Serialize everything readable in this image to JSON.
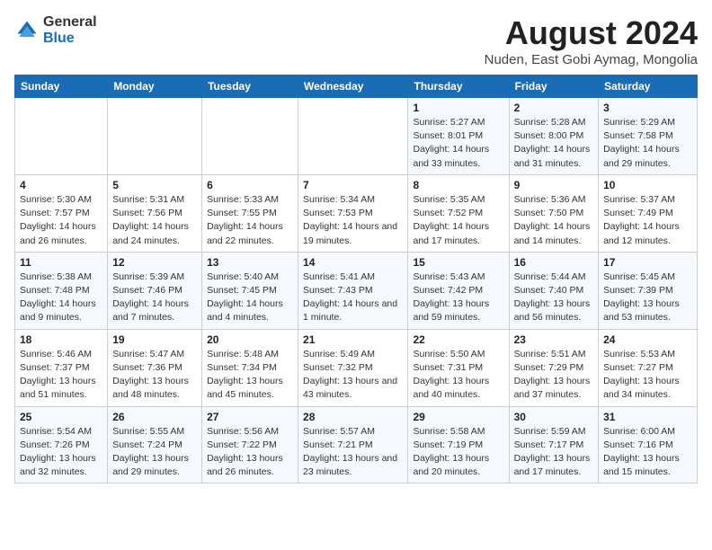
{
  "header": {
    "logo_general": "General",
    "logo_blue": "Blue",
    "title": "August 2024",
    "subtitle": "Nuden, East Gobi Aymag, Mongolia"
  },
  "calendar": {
    "days_of_week": [
      "Sunday",
      "Monday",
      "Tuesday",
      "Wednesday",
      "Thursday",
      "Friday",
      "Saturday"
    ],
    "weeks": [
      [
        {
          "day": "",
          "detail": ""
        },
        {
          "day": "",
          "detail": ""
        },
        {
          "day": "",
          "detail": ""
        },
        {
          "day": "",
          "detail": ""
        },
        {
          "day": "1",
          "detail": "Sunrise: 5:27 AM\nSunset: 8:01 PM\nDaylight: 14 hours\nand 33 minutes."
        },
        {
          "day": "2",
          "detail": "Sunrise: 5:28 AM\nSunset: 8:00 PM\nDaylight: 14 hours\nand 31 minutes."
        },
        {
          "day": "3",
          "detail": "Sunrise: 5:29 AM\nSunset: 7:58 PM\nDaylight: 14 hours\nand 29 minutes."
        }
      ],
      [
        {
          "day": "4",
          "detail": "Sunrise: 5:30 AM\nSunset: 7:57 PM\nDaylight: 14 hours\nand 26 minutes."
        },
        {
          "day": "5",
          "detail": "Sunrise: 5:31 AM\nSunset: 7:56 PM\nDaylight: 14 hours\nand 24 minutes."
        },
        {
          "day": "6",
          "detail": "Sunrise: 5:33 AM\nSunset: 7:55 PM\nDaylight: 14 hours\nand 22 minutes."
        },
        {
          "day": "7",
          "detail": "Sunrise: 5:34 AM\nSunset: 7:53 PM\nDaylight: 14 hours\nand 19 minutes."
        },
        {
          "day": "8",
          "detail": "Sunrise: 5:35 AM\nSunset: 7:52 PM\nDaylight: 14 hours\nand 17 minutes."
        },
        {
          "day": "9",
          "detail": "Sunrise: 5:36 AM\nSunset: 7:50 PM\nDaylight: 14 hours\nand 14 minutes."
        },
        {
          "day": "10",
          "detail": "Sunrise: 5:37 AM\nSunset: 7:49 PM\nDaylight: 14 hours\nand 12 minutes."
        }
      ],
      [
        {
          "day": "11",
          "detail": "Sunrise: 5:38 AM\nSunset: 7:48 PM\nDaylight: 14 hours\nand 9 minutes."
        },
        {
          "day": "12",
          "detail": "Sunrise: 5:39 AM\nSunset: 7:46 PM\nDaylight: 14 hours\nand 7 minutes."
        },
        {
          "day": "13",
          "detail": "Sunrise: 5:40 AM\nSunset: 7:45 PM\nDaylight: 14 hours\nand 4 minutes."
        },
        {
          "day": "14",
          "detail": "Sunrise: 5:41 AM\nSunset: 7:43 PM\nDaylight: 14 hours\nand 1 minute."
        },
        {
          "day": "15",
          "detail": "Sunrise: 5:43 AM\nSunset: 7:42 PM\nDaylight: 13 hours\nand 59 minutes."
        },
        {
          "day": "16",
          "detail": "Sunrise: 5:44 AM\nSunset: 7:40 PM\nDaylight: 13 hours\nand 56 minutes."
        },
        {
          "day": "17",
          "detail": "Sunrise: 5:45 AM\nSunset: 7:39 PM\nDaylight: 13 hours\nand 53 minutes."
        }
      ],
      [
        {
          "day": "18",
          "detail": "Sunrise: 5:46 AM\nSunset: 7:37 PM\nDaylight: 13 hours\nand 51 minutes."
        },
        {
          "day": "19",
          "detail": "Sunrise: 5:47 AM\nSunset: 7:36 PM\nDaylight: 13 hours\nand 48 minutes."
        },
        {
          "day": "20",
          "detail": "Sunrise: 5:48 AM\nSunset: 7:34 PM\nDaylight: 13 hours\nand 45 minutes."
        },
        {
          "day": "21",
          "detail": "Sunrise: 5:49 AM\nSunset: 7:32 PM\nDaylight: 13 hours\nand 43 minutes."
        },
        {
          "day": "22",
          "detail": "Sunrise: 5:50 AM\nSunset: 7:31 PM\nDaylight: 13 hours\nand 40 minutes."
        },
        {
          "day": "23",
          "detail": "Sunrise: 5:51 AM\nSunset: 7:29 PM\nDaylight: 13 hours\nand 37 minutes."
        },
        {
          "day": "24",
          "detail": "Sunrise: 5:53 AM\nSunset: 7:27 PM\nDaylight: 13 hours\nand 34 minutes."
        }
      ],
      [
        {
          "day": "25",
          "detail": "Sunrise: 5:54 AM\nSunset: 7:26 PM\nDaylight: 13 hours\nand 32 minutes."
        },
        {
          "day": "26",
          "detail": "Sunrise: 5:55 AM\nSunset: 7:24 PM\nDaylight: 13 hours\nand 29 minutes."
        },
        {
          "day": "27",
          "detail": "Sunrise: 5:56 AM\nSunset: 7:22 PM\nDaylight: 13 hours\nand 26 minutes."
        },
        {
          "day": "28",
          "detail": "Sunrise: 5:57 AM\nSunset: 7:21 PM\nDaylight: 13 hours\nand 23 minutes."
        },
        {
          "day": "29",
          "detail": "Sunrise: 5:58 AM\nSunset: 7:19 PM\nDaylight: 13 hours\nand 20 minutes."
        },
        {
          "day": "30",
          "detail": "Sunrise: 5:59 AM\nSunset: 7:17 PM\nDaylight: 13 hours\nand 17 minutes."
        },
        {
          "day": "31",
          "detail": "Sunrise: 6:00 AM\nSunset: 7:16 PM\nDaylight: 13 hours\nand 15 minutes."
        }
      ]
    ]
  }
}
